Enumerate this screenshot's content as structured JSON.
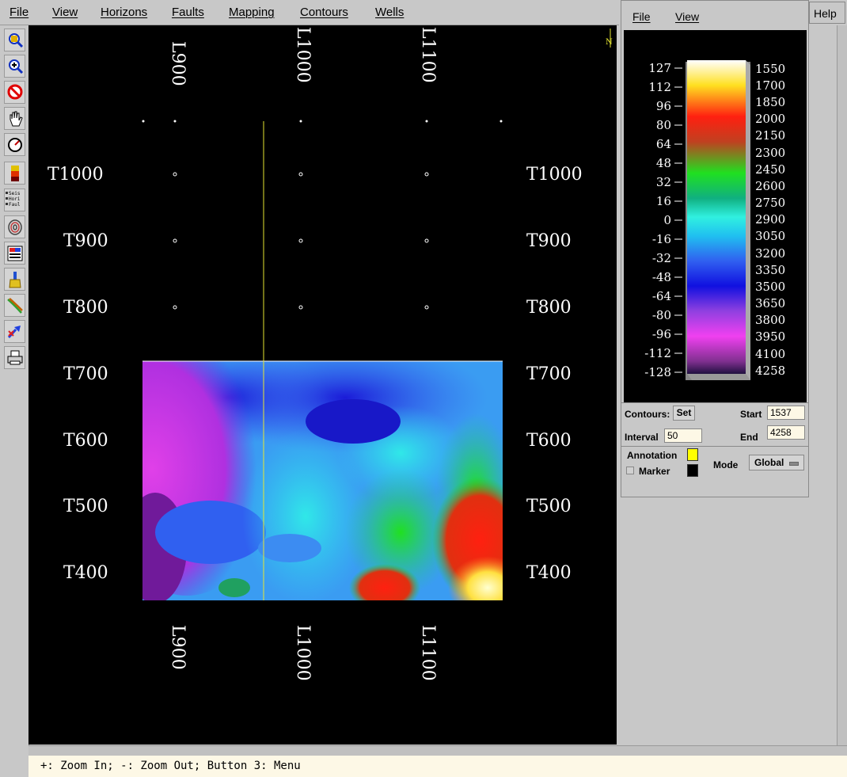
{
  "menubar": {
    "items": [
      "File",
      "View",
      "Horizons",
      "Faults",
      "Mapping",
      "Contours",
      "Wells"
    ],
    "help": "Help"
  },
  "toolbar": {
    "tools": [
      "zoom-icon",
      "zoom-in-icon",
      "zoom-cancel-icon",
      "pan-hand-icon",
      "gauge-icon",
      "colorbar-icon",
      "seis-hori-faul-toggle-icon",
      "contour-icon",
      "paint-icon",
      "brush-icon",
      "fault-line-icon",
      "pick-icon",
      "print-icon"
    ],
    "layer_labels": [
      "Seis",
      "Hori",
      "Faul"
    ]
  },
  "map": {
    "north_label": "N",
    "top_lines": [
      "L900",
      "L1000",
      "L1100"
    ],
    "bottom_lines": [
      "L900",
      "L1000",
      "L1100"
    ],
    "left_traces": [
      "T1000",
      "T900",
      "T800",
      "T700",
      "T600",
      "T500",
      "T400"
    ],
    "right_traces": [
      "T1000",
      "T900",
      "T800",
      "T700",
      "T600",
      "T500",
      "T400"
    ],
    "cursor_line_color": "#e6e632"
  },
  "panel": {
    "menu": [
      "File",
      "View"
    ],
    "legend_left": [
      "127",
      "112",
      "96",
      "80",
      "64",
      "48",
      "32",
      "16",
      "0",
      "-16",
      "-32",
      "-48",
      "-64",
      "-80",
      "-96",
      "-112",
      "-128"
    ],
    "legend_right": [
      "1550",
      "1700",
      "1850",
      "2000",
      "2150",
      "2300",
      "2450",
      "2600",
      "2750",
      "2900",
      "3050",
      "3200",
      "3350",
      "3500",
      "3650",
      "3800",
      "3950",
      "4100",
      "4258"
    ],
    "contours_label": "Contours:",
    "set_label": "Set",
    "start_label": "Start",
    "start_value": "1537",
    "interval_label": "Interval",
    "interval_value": "50",
    "end_label": "End",
    "end_value": "4258",
    "annotation_label": "Annotation",
    "annotation_color": "#ffff00",
    "marker_label": "Marker",
    "marker_color": "#000000",
    "mode_label": "Mode",
    "mode_value": "Global"
  },
  "status": {
    "text": "+: Zoom In; -: Zoom Out; Button 3: Menu"
  }
}
